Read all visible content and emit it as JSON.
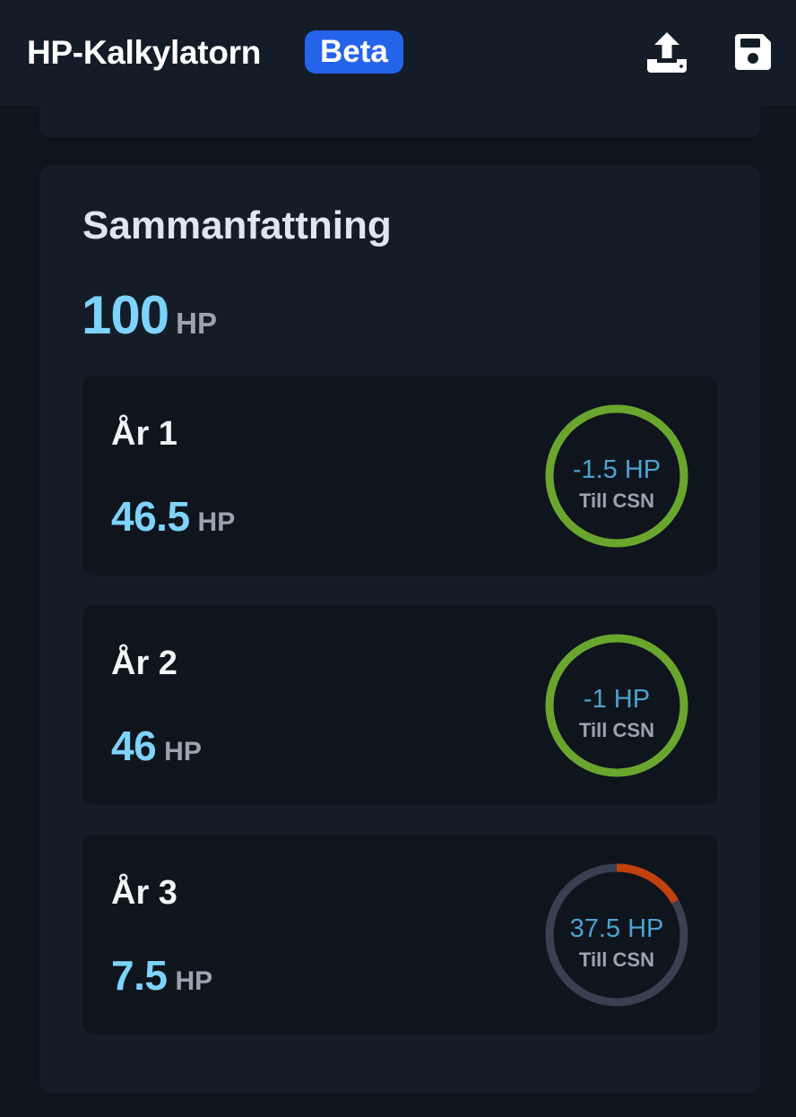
{
  "header": {
    "title": "HP-Kalkylatorn",
    "badge": "Beta"
  },
  "icons": {
    "upload": "upload-tray-icon",
    "save": "floppy-disk-icon"
  },
  "colors": {
    "accent_number": "#7dd3fc",
    "badge_bg": "#2563eb",
    "gauge_ok": "#6aa62d",
    "gauge_over": "#c2410c",
    "gauge_track": "#374151"
  },
  "summary": {
    "title": "Sammanfattning",
    "total_value": "100",
    "total_unit": "HP",
    "years": [
      {
        "title": "År 1",
        "hp_value": "46.5",
        "hp_unit": "HP",
        "gauge_value": "-1.5 HP",
        "gauge_label": "Till CSN",
        "gauge_progress": 1.0,
        "gauge_status": "ok"
      },
      {
        "title": "År 2",
        "hp_value": "46",
        "hp_unit": "HP",
        "gauge_value": "-1 HP",
        "gauge_label": "Till CSN",
        "gauge_progress": 1.0,
        "gauge_status": "ok"
      },
      {
        "title": "År 3",
        "hp_value": "7.5",
        "hp_unit": "HP",
        "gauge_value": "37.5 HP",
        "gauge_label": "Till CSN",
        "gauge_progress": 0.167,
        "gauge_status": "over"
      }
    ]
  }
}
